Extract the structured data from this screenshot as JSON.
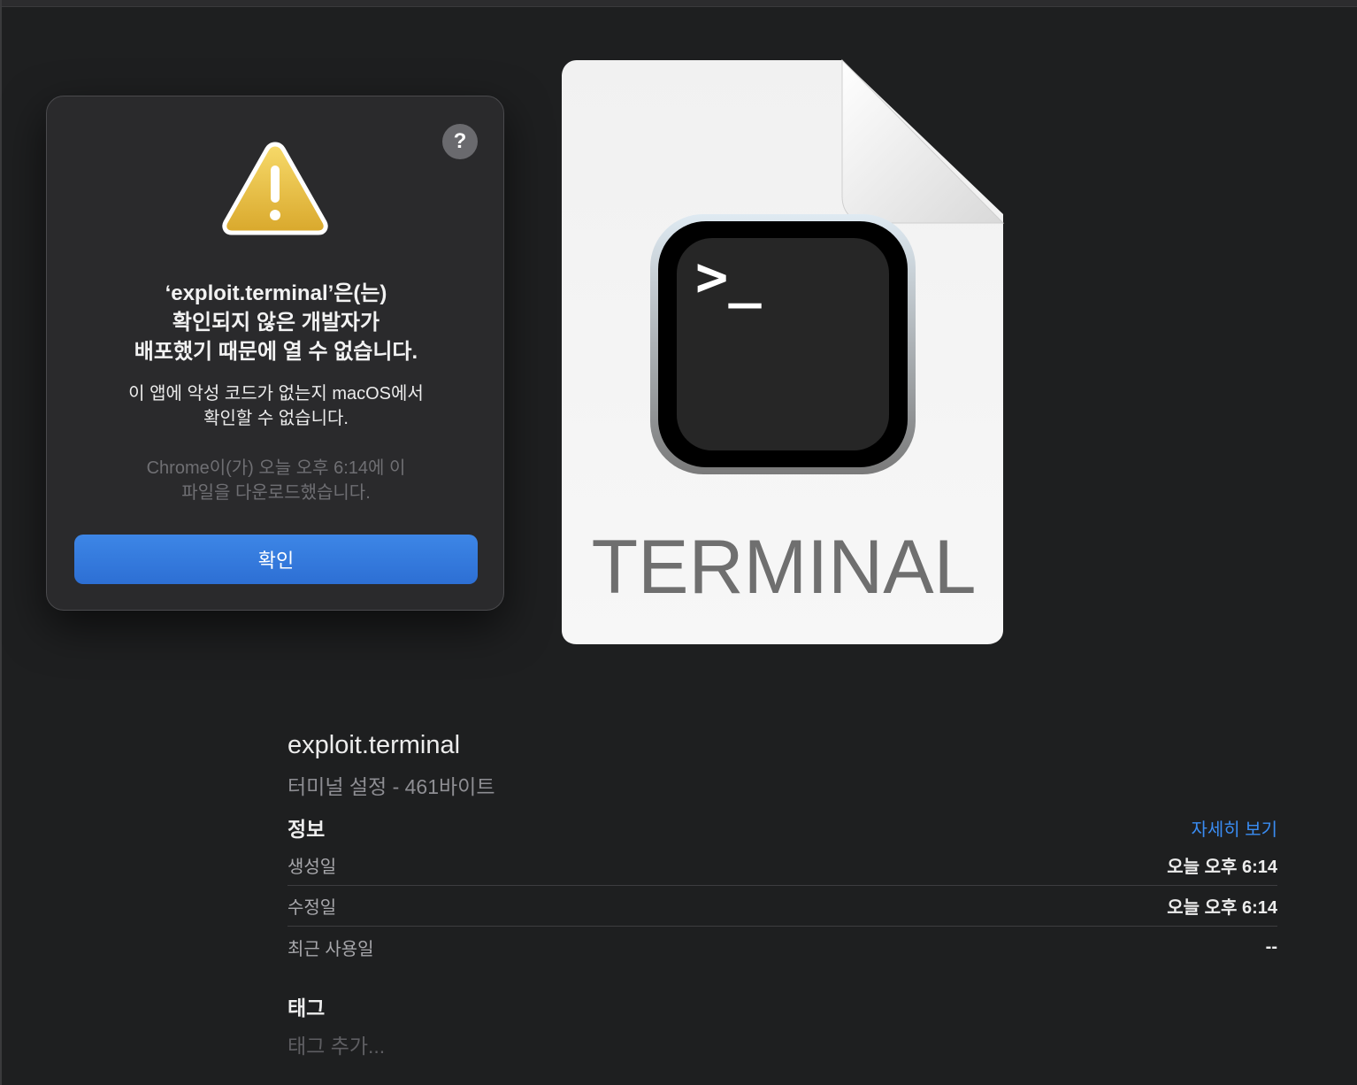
{
  "alert": {
    "title": "‘exploit.terminal’은(는)\n확인되지 않은 개발자가\n배포했기 때문에 열 수 없습니다.",
    "message": "이 앱에 악성 코드가 없는지 macOS에서\n확인할 수 없습니다.",
    "note": "Chrome이(가) 오늘 오후 6:14에 이\n파일을 다운로드했습니다.",
    "ok_label": "확인",
    "help_label": "?",
    "icon": "warning-triangle-icon"
  },
  "preview": {
    "icon": "terminal-document-icon",
    "prompt": ">_",
    "caption": "TERMINAL"
  },
  "info": {
    "file_name": "exploit.terminal",
    "file_kind": "터미널 설정 - 461바이트",
    "section_title": "정보",
    "more_link": "자세히 보기",
    "rows": [
      {
        "label": "생성일",
        "value": "오늘 오후 6:14"
      },
      {
        "label": "수정일",
        "value": "오늘 오후 6:14"
      },
      {
        "label": "최근 사용일",
        "value": "--"
      }
    ]
  },
  "tags": {
    "section_title": "태그",
    "placeholder": "태그 추가..."
  },
  "colors": {
    "background": "#1e1f20",
    "accent": "#2d6fd4",
    "link": "#3a8cf2",
    "warning": "#e6b93a"
  }
}
